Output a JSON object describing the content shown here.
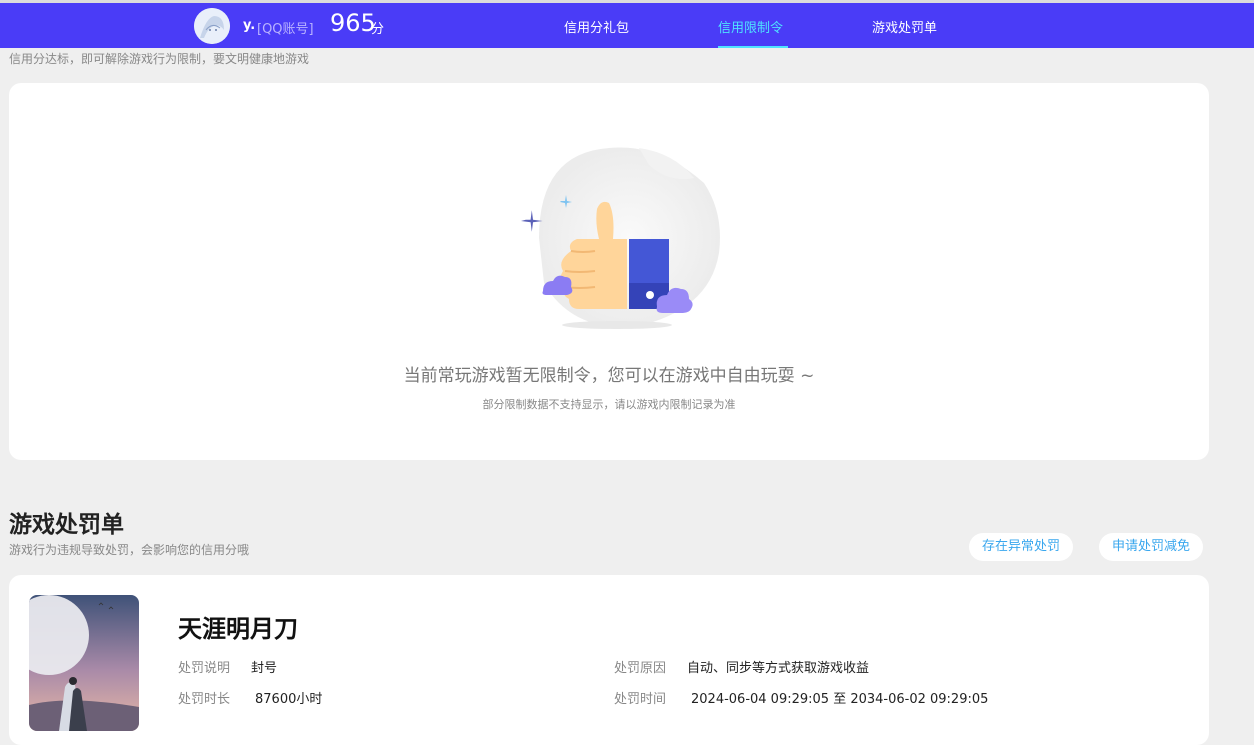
{
  "header": {
    "username": "y.",
    "account_type": "[QQ账号]",
    "score": "965",
    "score_unit": "分",
    "nav": [
      "信用分礼包",
      "信用限制令",
      "游戏处罚单"
    ],
    "active_color": "#4fe3ff",
    "brand_color": "#4a3cf7"
  },
  "restriction": {
    "subtitle": "信用分达标，即可解除游戏行为限制，要文明健康地游戏",
    "empty_message": "当前常玩游戏暂无限制令，您可以在游戏中自由玩耍 ~",
    "note": "部分限制数据不支持显示，请以游戏内限制记录为准",
    "illustration_icon": "thumbs-up-icon"
  },
  "penalty": {
    "title": "游戏处罚单",
    "desc": "游戏行为违规导致处罚，会影响您的信用分哦",
    "btn_abnormal": "存在异常处罚",
    "btn_appeal": "申请处罚减免",
    "item": {
      "game": "天涯明月刀",
      "reason_label": "处罚说明",
      "reason_value": "封号",
      "cause_label": "处罚原因",
      "cause_value": "自动、同步等方式获取游戏收益",
      "duration_label": "处罚时长",
      "duration_value": "87600小时",
      "time_label": "处罚时间",
      "time_value": "2024-06-04 09:29:05 至 2034-06-02 09:29:05"
    }
  }
}
